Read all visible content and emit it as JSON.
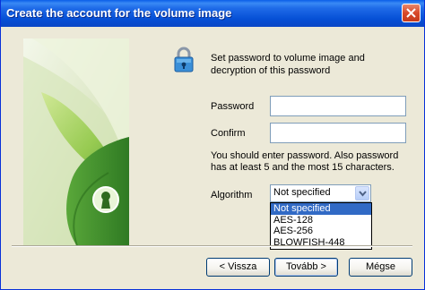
{
  "window": {
    "title": "Create the account for the volume image"
  },
  "info_text": "Set password to volume image and decryption of this password",
  "form": {
    "password_label": "Password",
    "confirm_label": "Confirm",
    "password_value": "",
    "confirm_value": "",
    "hint": "You should enter password. Also password has at least 5 and the most 15 characters.",
    "algorithm_label": "Algorithm",
    "algorithm_selected": "Not specified",
    "algorithm_options": [
      "Not specified",
      "AES-128",
      "AES-256",
      "BLOWFISH-448"
    ]
  },
  "buttons": {
    "back": "< Vissza",
    "next": "Tovább >",
    "cancel": "Mégse"
  },
  "icons": {
    "close": "close-icon",
    "lock": "lock-icon",
    "dropdown": "chevron-down-icon",
    "banner": "leaf-keyhole-banner"
  },
  "colors": {
    "titlebar": "#0a5ee8",
    "selection": "#316ac5",
    "dialog_bg": "#ece9d8",
    "input_border": "#7f9db9"
  }
}
